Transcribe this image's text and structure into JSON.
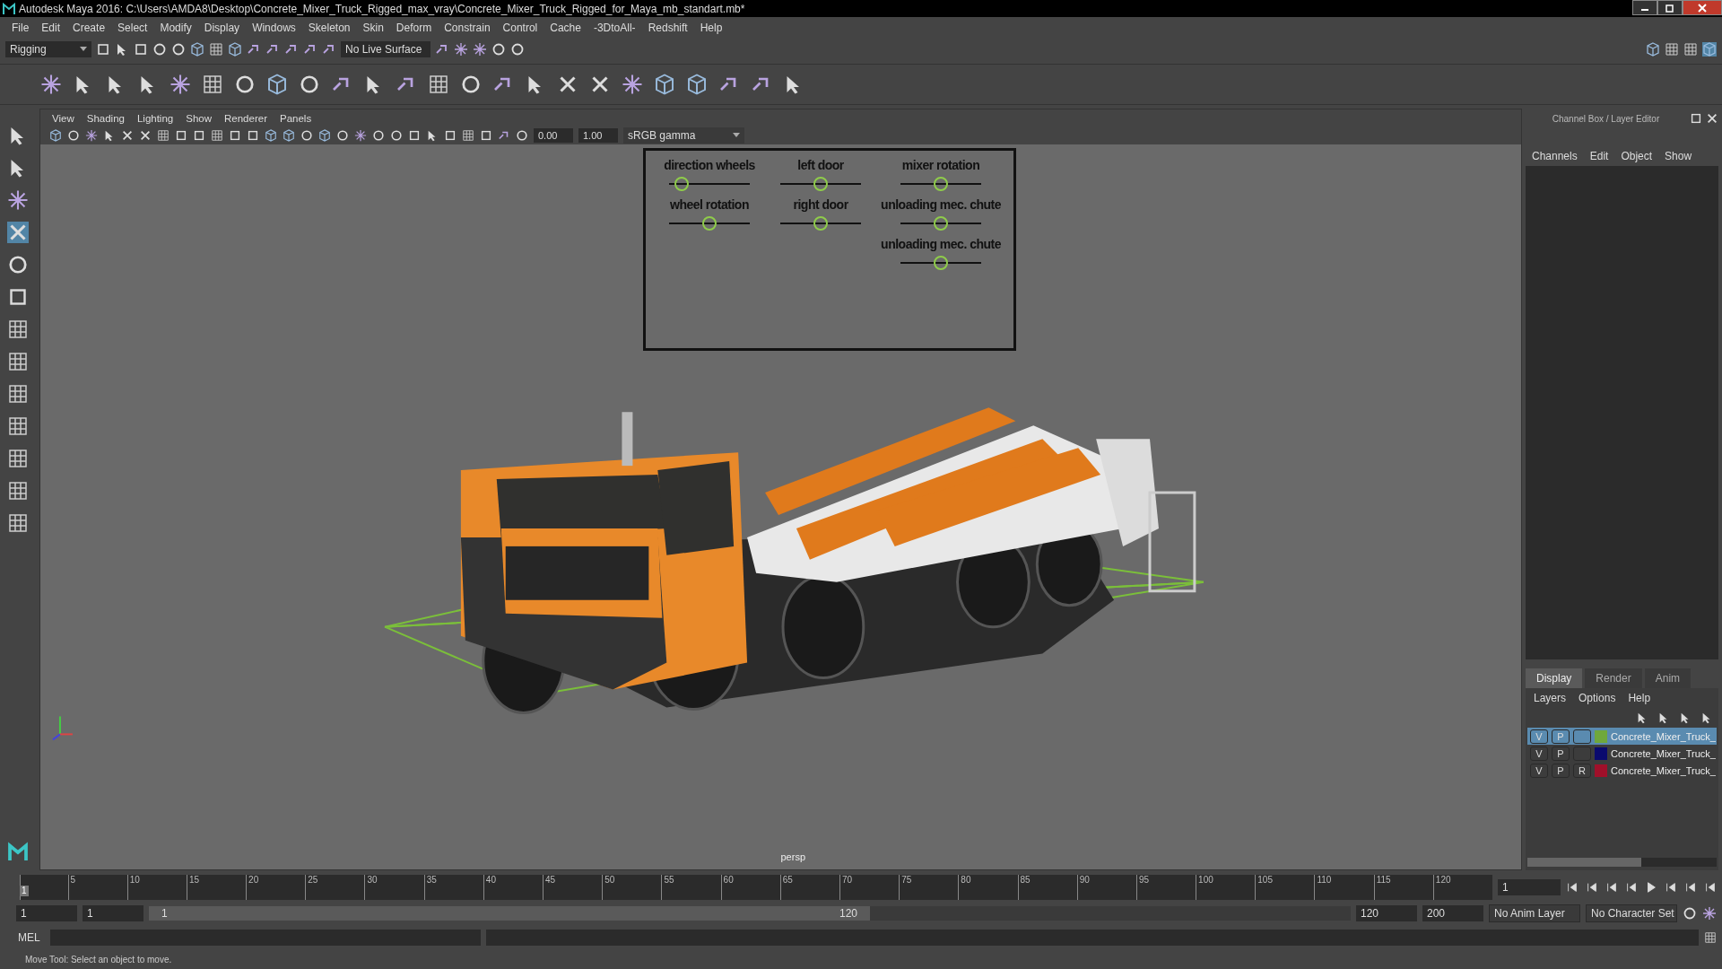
{
  "window": {
    "title": "Autodesk Maya 2016: C:\\Users\\AMDA8\\Desktop\\Concrete_Mixer_Truck_Rigged_max_vray\\Concrete_Mixer_Truck_Rigged_for_Maya_mb_standart.mb*"
  },
  "menu": [
    "File",
    "Edit",
    "Create",
    "Select",
    "Modify",
    "Display",
    "Windows",
    "Skeleton",
    "Skin",
    "Deform",
    "Constrain",
    "Control",
    "Cache",
    "-3DtoAll-",
    "Redshift",
    "Help"
  ],
  "status_line": {
    "menu_set": "Rigging",
    "live_surface": "No Live Surface"
  },
  "viewport": {
    "menu": [
      "View",
      "Shading",
      "Lighting",
      "Show",
      "Renderer",
      "Panels"
    ],
    "exposure": "0.00",
    "gamma": "1.00",
    "color_space": "sRGB gamma",
    "camera": "persp",
    "rig_controls": [
      {
        "label": "direction wheels",
        "level": 0.15
      },
      {
        "label": "left door",
        "level": 0.5
      },
      {
        "label": "mixer rotation",
        "level": 0.5
      },
      {
        "label": "wheel rotation",
        "level": 0.5
      },
      {
        "label": "right door",
        "level": 0.5
      },
      {
        "label": "unloading mec. chute",
        "level": 0.5
      },
      {
        "label": "unloading mec. chute",
        "level": 0.5
      }
    ]
  },
  "channel_box": {
    "title": "Channel Box / Layer Editor",
    "menu": [
      "Channels",
      "Edit",
      "Object",
      "Show"
    ]
  },
  "layer_editor": {
    "tabs": [
      {
        "label": "Display",
        "selected": true
      },
      {
        "label": "Render",
        "selected": false
      },
      {
        "label": "Anim",
        "selected": false
      }
    ],
    "menu": [
      "Layers",
      "Options",
      "Help"
    ],
    "layers": [
      {
        "flags": [
          "V",
          "P"
        ],
        "color": "#6fa83c",
        "name": "Concrete_Mixer_Truck_",
        "selected": true
      },
      {
        "flags": [
          "V",
          "P"
        ],
        "color": "#0a0a6e",
        "name": "Concrete_Mixer_Truck_",
        "selected": false
      },
      {
        "flags": [
          "V",
          "P",
          "R"
        ],
        "color": "#a0102a",
        "name": "Concrete_Mixer_Truck_",
        "selected": false
      }
    ]
  },
  "timeline": {
    "start_label": "1",
    "ticks": [
      "5",
      "10",
      "15",
      "20",
      "25",
      "30",
      "35",
      "40",
      "45",
      "50",
      "55",
      "60",
      "65",
      "70",
      "75",
      "80",
      "85",
      "90",
      "95",
      "100",
      "105",
      "110",
      "115",
      "120"
    ],
    "current_frame": "1",
    "level": 0
  },
  "range": {
    "start": "1",
    "playback_start": "1",
    "slider_start": "1",
    "slider_end": "120",
    "level": 0.6,
    "playback_end": "120",
    "end": "200",
    "anim_layer": "No Anim Layer",
    "character_set": "No Character Set"
  },
  "command_line": {
    "label": "MEL"
  },
  "status_bar": "Move Tool: Select an object to move."
}
